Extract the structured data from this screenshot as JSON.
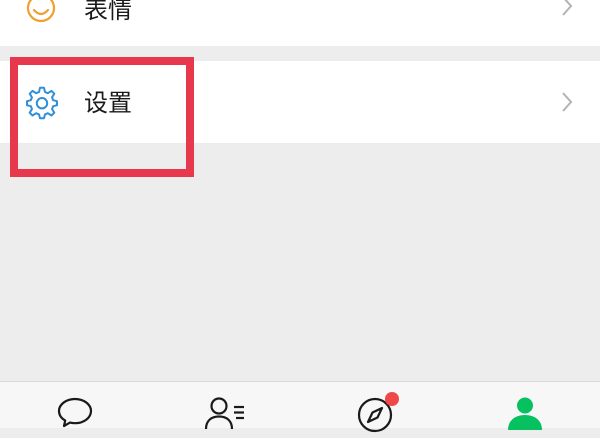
{
  "menu": {
    "expression_label": "表情",
    "settings_label": "设置"
  },
  "tabbar": {
    "items": [
      "chat-icon",
      "contacts-icon",
      "discover-icon",
      "me-icon"
    ],
    "active": "me",
    "discover_badge": true
  },
  "colors": {
    "background": "#ededed",
    "expression_icon": "#f0a030",
    "settings_icon": "#2f8fd8",
    "highlight": "#e8384e",
    "active_tab": "#07c160",
    "badge": "#f04848"
  }
}
